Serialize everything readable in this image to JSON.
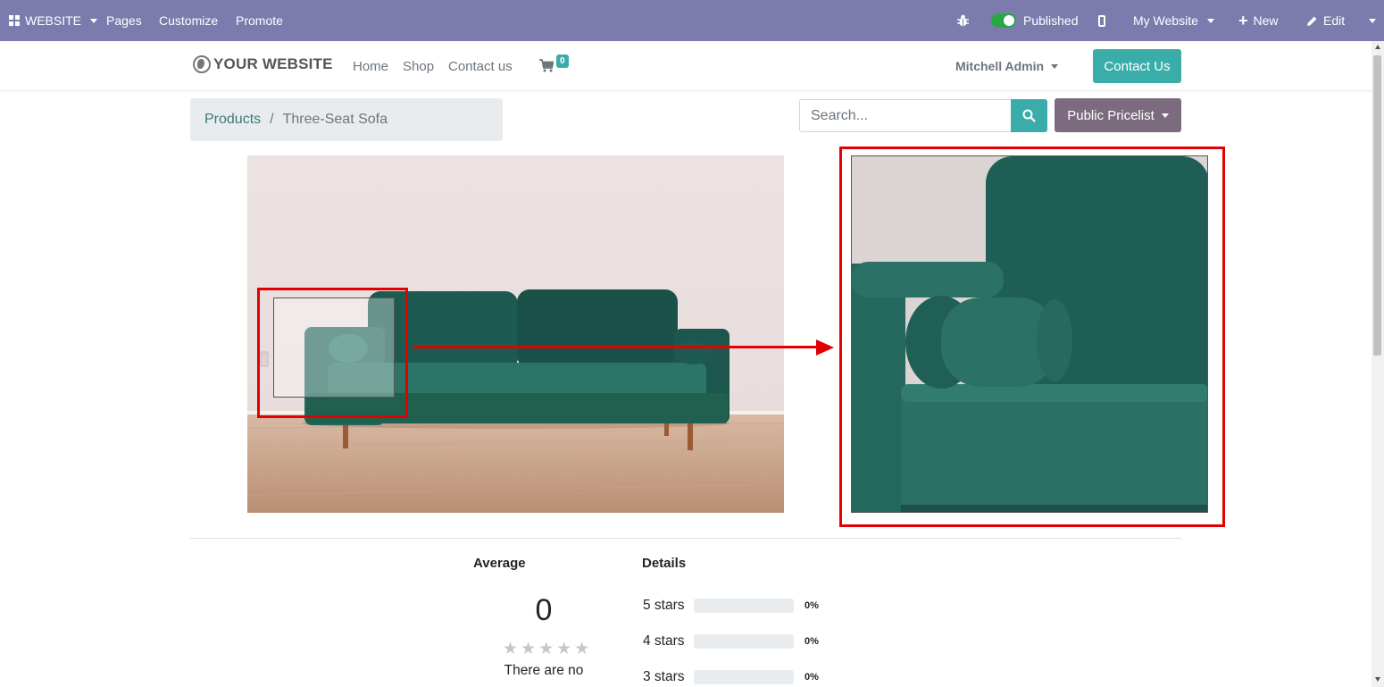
{
  "admin_bar": {
    "app_menu_label": "WEBSITE",
    "menu_items": [
      "Pages",
      "Customize",
      "Promote"
    ],
    "debug_icon": "bug-icon",
    "published_label": "Published",
    "published_on": true,
    "mobile_icon": "mobile-icon",
    "site_selector_label": "My Website",
    "new_label": "New",
    "edit_label": "Edit"
  },
  "site_header": {
    "logo_text": "YOUR WEBSITE",
    "nav_items": [
      "Home",
      "Shop",
      "Contact us"
    ],
    "cart_count": "0",
    "user_name": "Mitchell Admin",
    "contact_button": "Contact Us"
  },
  "breadcrumb": {
    "parent": "Products",
    "separator": "/",
    "current": "Three-Seat Sofa"
  },
  "search": {
    "placeholder": "Search..."
  },
  "pricelist": {
    "label": "Public Pricelist"
  },
  "product": {
    "image_subject": "green velvet three-seat sofa",
    "zoom_subject": "zoomed sofa armrest with bolster cushion"
  },
  "colors": {
    "admin_bar": "#7c7bad",
    "accent": "#3aadaa",
    "pricelist": "#7c6b7f",
    "annotation": "#e30000"
  },
  "ratings": {
    "average_title": "Average",
    "average_value": "0",
    "star_count": 5,
    "no_reviews_text": "There are no",
    "details_title": "Details",
    "rows": [
      {
        "label": "5 stars",
        "percent_text": "0%",
        "fill": 0
      },
      {
        "label": "4 stars",
        "percent_text": "0%",
        "fill": 0
      },
      {
        "label": "3 stars",
        "percent_text": "0%",
        "fill": 0
      }
    ]
  }
}
